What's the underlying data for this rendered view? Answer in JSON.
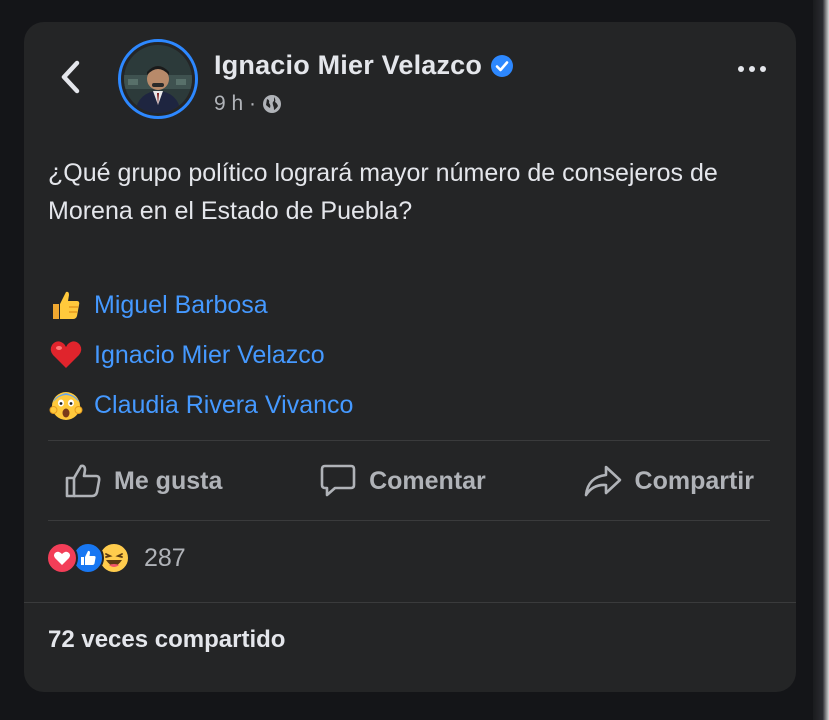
{
  "post": {
    "author": "Ignacio Mier Velazco",
    "time": "9 h ·",
    "text": "¿Qué grupo político logrará mayor número de consejeros de Morena en el Estado de Puebla?",
    "options": [
      {
        "icon": "thumbs-up-emoji",
        "label": "Miguel Barbosa"
      },
      {
        "icon": "red-heart-emoji",
        "label": "Ignacio Mier Velazco"
      },
      {
        "icon": "screaming-face-emoji",
        "label": "Claudia Rivera Vivanco"
      }
    ]
  },
  "actions": {
    "like": "Me gusta",
    "comment": "Comentar",
    "share": "Compartir"
  },
  "reactions": {
    "icons": [
      "heart-reaction",
      "like-reaction",
      "haha-reaction"
    ],
    "count": "287"
  },
  "shares": "72 veces compartido",
  "colors": {
    "card_bg": "#242526",
    "link": "#4599ff",
    "verified": "#2d88ff",
    "text_primary": "#e4e6eb",
    "text_secondary": "#b0b3b8"
  }
}
